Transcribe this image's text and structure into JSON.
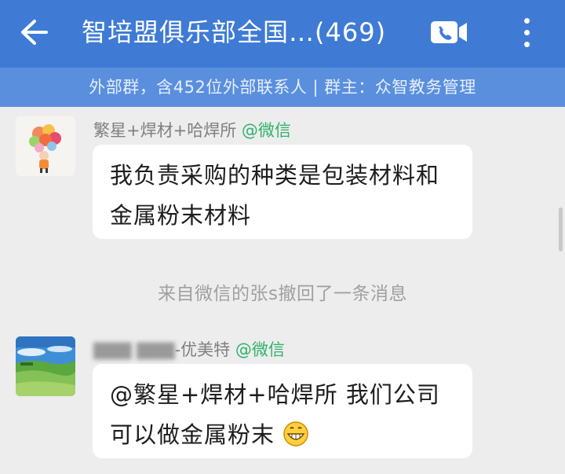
{
  "header": {
    "back_icon": "arrow-left-icon",
    "title": "智培盟俱乐部全国…(469)",
    "video_icon": "video-call-icon",
    "more_icon": "more-vertical-icon"
  },
  "group_info": "外部群，含452位外部联系人 | 群主：众智教务管理",
  "messages": [
    {
      "sender": "繁星+焊材+哈焊所",
      "source_tag": "@微信",
      "text": "我负责采购的种类是包装材料和金属粉末材料"
    },
    {
      "sender_visible": "-优美特",
      "source_tag": "@微信",
      "text": "@繁星+焊材+哈焊所 我们公司可以做金属粉末",
      "emoji": "grinning-face-icon"
    }
  ],
  "system_notice": "来自微信的张s撤回了一条消息",
  "colors": {
    "header_bg": "#3f7bd5",
    "subheader_bg": "#5a8fde",
    "chat_bg": "#ededed",
    "wechat_green": "#2fb26a"
  }
}
